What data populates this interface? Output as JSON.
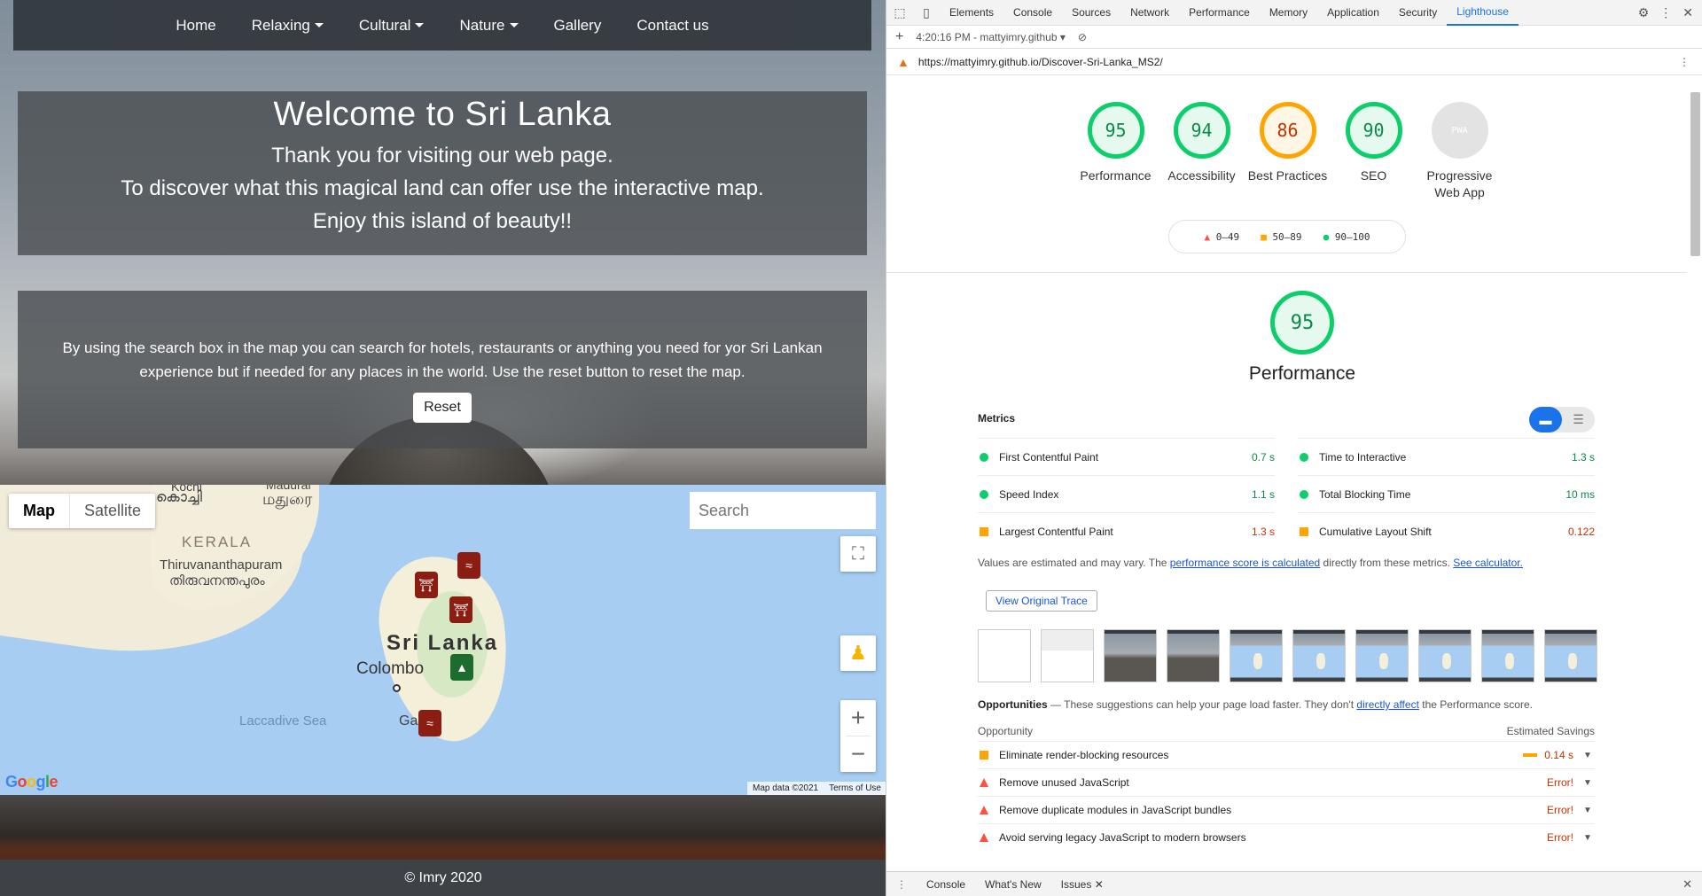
{
  "site": {
    "nav": {
      "home": "Home",
      "relaxing": "Relaxing",
      "cultural": "Cultural",
      "nature": "Nature",
      "gallery": "Gallery",
      "contact": "Contact us"
    },
    "welcome": {
      "title": "Welcome to Sri Lanka",
      "line1": "Thank you for visiting our web page.",
      "line2": "To discover what this magical land can offer use the interactive map.",
      "line3": "Enjoy this island of beauty!!"
    },
    "info": {
      "text": "By using the search box in the map you can search for hotels, restaurants or anything you need for yor Sri Lankan experience but if needed for any places in the world. Use the reset button to reset the map.",
      "reset_label": "Reset"
    },
    "map": {
      "type_map": "Map",
      "type_satellite": "Satellite",
      "search_placeholder": "Search",
      "labels": {
        "kochi": "Kochi",
        "kochi_ml": "കൊച്ചി",
        "madurai": "Madurai",
        "madurai_ta": "மதுரை",
        "kerala": "KERALA",
        "tvm": "Thiruvananthapuram",
        "tvm_ml": "തിരുവനന്തപുരം",
        "sri_lanka": "Sri Lanka",
        "colombo": "Colombo",
        "laccadive": "Laccadive Sea",
        "galle": "Ga"
      },
      "google": "Google",
      "map_data": "Map data ©2021",
      "terms": "Terms of Use"
    },
    "footer": "© Imry 2020"
  },
  "devtools": {
    "tabs": [
      "Elements",
      "Console",
      "Sources",
      "Network",
      "Performance",
      "Memory",
      "Application",
      "Security",
      "Lighthouse"
    ],
    "active_tab": "Lighthouse",
    "report_time": "4:20:16 PM - mattyimry.github",
    "url": "https://mattyimry.github.io/Discover-Sri-Lanka_MS2/",
    "scores": [
      {
        "label": "Performance",
        "score": "95",
        "level": "green"
      },
      {
        "label": "Accessibility",
        "score": "94",
        "level": "green"
      },
      {
        "label": "Best Practices",
        "score": "86",
        "level": "orange"
      },
      {
        "label": "SEO",
        "score": "90",
        "level": "green"
      },
      {
        "label": "Progressive Web App",
        "score": "PWA",
        "level": "pwa"
      }
    ],
    "legend": {
      "fail": "0–49",
      "average": "50–89",
      "pass": "90–100"
    },
    "performance": {
      "score": "95",
      "title": "Performance",
      "metrics_heading": "Metrics",
      "metrics": [
        {
          "label": "First Contentful Paint",
          "value": "0.7 s",
          "level": "g"
        },
        {
          "label": "Time to Interactive",
          "value": "1.3 s",
          "level": "g"
        },
        {
          "label": "Speed Index",
          "value": "1.1 s",
          "level": "g"
        },
        {
          "label": "Total Blocking Time",
          "value": "10 ms",
          "level": "g"
        },
        {
          "label": "Largest Contentful Paint",
          "value": "1.3 s",
          "level": "o"
        },
        {
          "label": "Cumulative Layout Shift",
          "value": "0.122",
          "level": "o"
        }
      ],
      "note_prefix": "Values are estimated and may vary. The ",
      "note_link1": "performance score is calculated",
      "note_mid": " directly from these metrics. ",
      "note_link2": "See calculator.",
      "trace_label": "View Original Trace"
    },
    "opportunities": {
      "heading": "Opportunities",
      "desc_prefix": " — These suggestions can help your page load faster. They don't ",
      "desc_link": "directly affect",
      "desc_suffix": " the Performance score.",
      "col_opportunity": "Opportunity",
      "col_savings": "Estimated Savings",
      "items": [
        {
          "label": "Eliminate render-blocking resources",
          "value": "0.14 s",
          "level": "o"
        },
        {
          "label": "Remove unused JavaScript",
          "value": "Error!",
          "level": "r"
        },
        {
          "label": "Remove duplicate modules in JavaScript bundles",
          "value": "Error!",
          "level": "r"
        },
        {
          "label": "Avoid serving legacy JavaScript to modern browsers",
          "value": "Error!",
          "level": "r"
        }
      ]
    },
    "drawer": {
      "console": "Console",
      "whats_new": "What's New",
      "issues": "Issues"
    }
  }
}
